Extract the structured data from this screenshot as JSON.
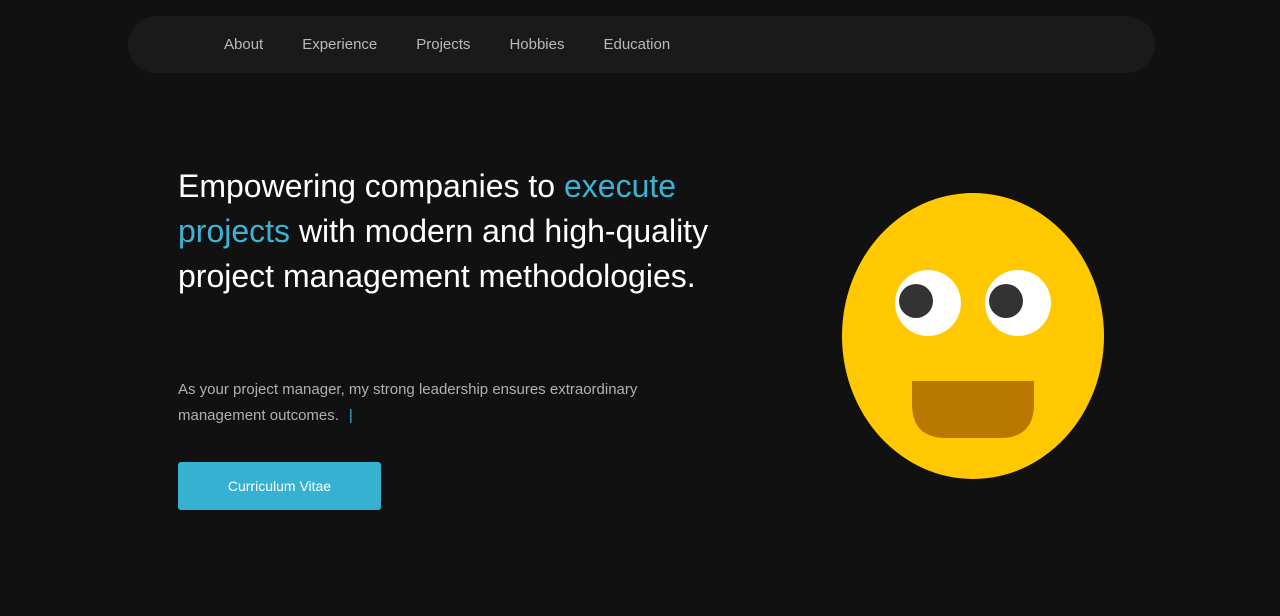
{
  "nav": {
    "items": [
      {
        "label": "About"
      },
      {
        "label": "Experience"
      },
      {
        "label": "Projects"
      },
      {
        "label": "Hobbies"
      },
      {
        "label": "Education"
      }
    ]
  },
  "hero": {
    "title_part1": "Empowering companies to ",
    "title_accent": "execute projects",
    "title_part2": " with modern and high-quality project management methodologies.",
    "subtitle": "As your project manager, my strong leadership ensures extraordinary management outcomes.",
    "cursor": "|",
    "cv_button": "Curriculum Vitae"
  },
  "colors": {
    "accent": "#3db3d4",
    "button": "#36b1d2",
    "background": "#111111",
    "nav_background": "#1b1a1b",
    "smiley_face": "#ffc800",
    "smiley_mouth": "#b97800"
  },
  "illustration": {
    "icon": "smiley-face-icon"
  }
}
